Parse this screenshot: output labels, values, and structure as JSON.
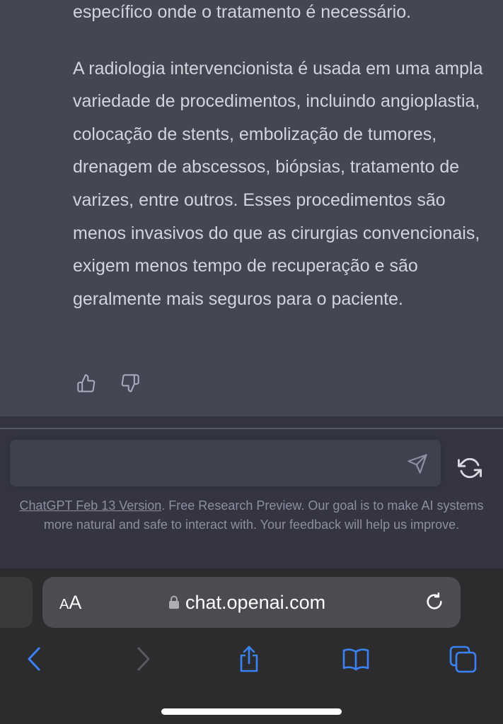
{
  "message": {
    "line_top": "específico onde o tratamento é necessário.",
    "paragraph": "A radiologia intervencionista é usada em uma ampla variedade de procedimentos, incluindo angioplastia, colocação de stents, embolização de tumores, drenagem de abscessos, biópsias, tratamento de varizes, entre outros. Esses procedimentos são menos invasivos do que as cirurgias convencionais, exigem menos tempo de recuperação e são geralmente mais seguros para o paciente."
  },
  "feedback": {
    "thumbs_up_icon": "thumbs-up-icon",
    "thumbs_down_icon": "thumbs-down-icon"
  },
  "composer": {
    "input_value": "",
    "send_icon": "paper-plane-icon",
    "regenerate_icon": "refresh-icon"
  },
  "disclaimer": {
    "version_link": "ChatGPT Feb 13 Version",
    "text": ". Free Research Preview. Our goal is to make AI systems more natural and safe to interact with. Your feedback will help us improve."
  },
  "browser": {
    "aa_small": "A",
    "aa_large": "A",
    "url": "chat.openai.com",
    "lock_icon": "lock-icon",
    "reload_icon": "reload-icon",
    "toolbar": [
      "back-icon",
      "forward-icon",
      "share-icon",
      "bookmarks-icon",
      "tabs-icon"
    ]
  },
  "colors": {
    "accent": "#3b82f6",
    "message_bg": "#444654",
    "composer_bg": "#343541",
    "text": "#d1d5db",
    "muted": "#8e8ea0"
  }
}
